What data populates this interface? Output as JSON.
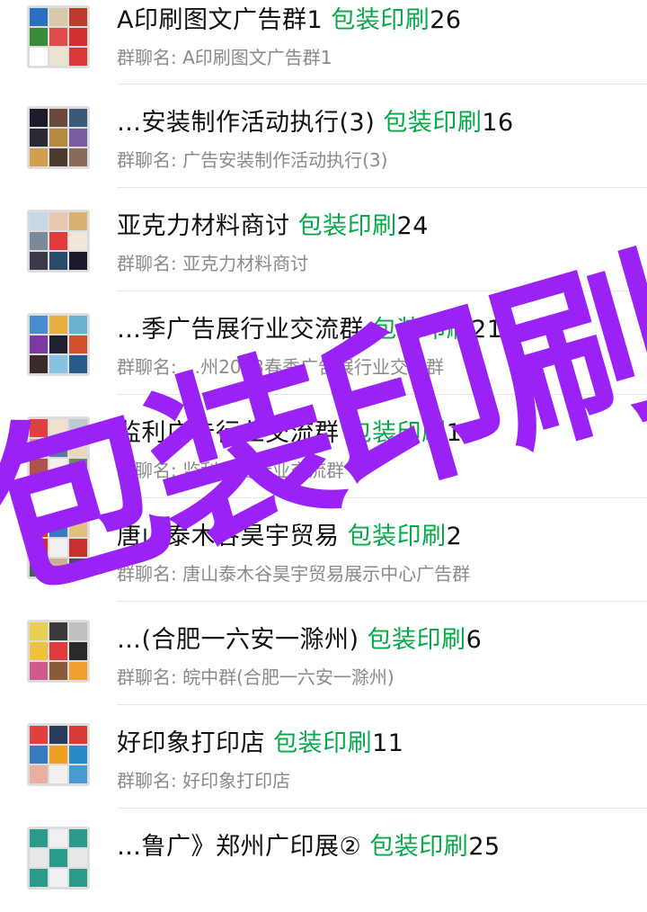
{
  "highlight_color": "#07a84a",
  "watermark": {
    "text": "包装印刷",
    "color": "#9b22f5"
  },
  "groups": [
    {
      "name": "A印刷图文广告群1",
      "keyword": "包装印刷",
      "count": "26",
      "subtitle": "群聊名: A印刷图文广告群1"
    },
    {
      "name": "…安装制作活动执行(3)",
      "keyword": "包装印刷",
      "count": "16",
      "subtitle": "群聊名: 广告安装制作活动执行(3)"
    },
    {
      "name": "亚克力材料商讨",
      "keyword": "包装印刷",
      "count": "24",
      "subtitle": "群聊名: 亚克力材料商讨"
    },
    {
      "name": "…季广告展行业交流群",
      "keyword": "包装印刷",
      "count": "21",
      "subtitle": "群聊名: …州2023春季广告展行业交流群"
    },
    {
      "name": "监利广告行业交流群",
      "keyword": "包装印刷",
      "count": "18",
      "subtitle": "群聊名: 监利广告行业交流群"
    },
    {
      "name": "唐山泰木谷昊宇贸易",
      "keyword": "包装印刷",
      "count": "2",
      "subtitle": "群聊名: 唐山泰木谷昊宇贸易展示中心广告群"
    },
    {
      "name": "…(合肥一六安一滁州)",
      "keyword": "包装印刷",
      "count": "6",
      "subtitle": "群聊名: 皖中群(合肥一六安一滁州)"
    },
    {
      "name": "好印象打印店",
      "keyword": "包装印刷",
      "count": "11",
      "subtitle": "群聊名: 好印象打印店"
    },
    {
      "name": "…鲁广》郑州广印展②",
      "keyword": "包装印刷",
      "count": "25",
      "subtitle": ""
    }
  ]
}
